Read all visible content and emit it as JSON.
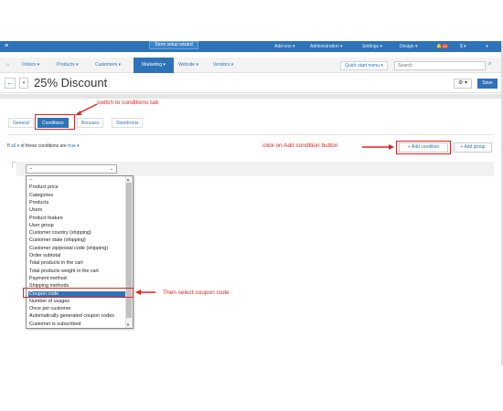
{
  "topbar": {
    "wizard_label": "Store setup wizard",
    "addons": "Add-ons ▾",
    "administration": "Administration ▾",
    "settings": "Settings ▾",
    "design": "Design ▾",
    "notification_count": "40",
    "currency": "$ ▾",
    "user": "▾"
  },
  "nav": {
    "orders": "Orders ▾",
    "products": "Products ▾",
    "customers": "Customers ▾",
    "marketing": "Marketing ▾",
    "website": "Website ▾",
    "vendors": "Vendors ▾",
    "quick_start": "Quick start menu ▾",
    "search_placeholder": "Search"
  },
  "title_bar": {
    "title": "25% Discount",
    "save_label": "Save",
    "gear_label": "⚙ ▾"
  },
  "tabs": [
    {
      "label": "General"
    },
    {
      "label": "Conditions"
    },
    {
      "label": "Bonuses"
    },
    {
      "label": "Storefronts"
    }
  ],
  "conditions": {
    "prefix": "If",
    "all_link": "all ▾",
    "middle": "of these conditions are",
    "true_link": "true ▾",
    "add_condition": "+ Add condition",
    "add_group": "+ Add group",
    "selected_value": "--"
  },
  "options": [
    "--",
    "Product price",
    "Categories",
    "Products",
    "Users",
    "Product feature",
    "User group",
    "Customer country (shipping)",
    "Customer state (shipping)",
    "Customer zip/postal code (shipping)",
    "Order subtotal",
    "Total products in the cart",
    "Total products weight in the cart",
    "Payment method",
    "Shipping methods",
    "Coupon code",
    "Number of usages",
    "Once per customer",
    "Automatically generated coupon codes",
    "Customer is subscribed"
  ],
  "selected_option_index": 15,
  "annotations": {
    "tab_note": "switch to conditions tab",
    "add_note": "click on Add condition button",
    "coupon_note": "Then select coupon code"
  },
  "colors": {
    "brand": "#2e73b8",
    "annotation": "#e02424"
  }
}
